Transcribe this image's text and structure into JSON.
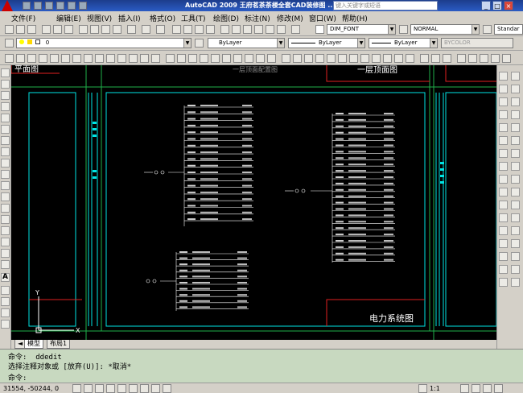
{
  "titlebar": {
    "title": "AutoCAD 2009  王府茗茶茶楼全套CAD装修图 ...",
    "search_placeholder": "键入关键字或短语",
    "min": "_",
    "max": "□",
    "close": "×"
  },
  "menu": [
    "文件(F)",
    "编辑(E)",
    "视图(V)",
    "插入(I)",
    "格式(O)",
    "工具(T)",
    "绘图(D)",
    "标注(N)",
    "修改(M)",
    "窗口(W)",
    "帮助(H)"
  ],
  "toolbar": {
    "textstyle": "DIM_FONT",
    "dimstyle": "NORMAL",
    "tablestyle": "Standar",
    "layer": "0",
    "color": "ByLayer",
    "linetype": "ByLayer",
    "lineweight": "ByLayer",
    "plotstyle": "BYCOLOR"
  },
  "drawing": {
    "labels": {
      "top_left": "平面图",
      "top_center": "一层顶面配置图",
      "top_right": "一层顶面图",
      "bottom_right": "电力系统图",
      "ucs_y": "Y",
      "ucs_x": "X"
    }
  },
  "tabs": [
    "模型",
    "布局1"
  ],
  "command": {
    "line1_prefix": "命令:",
    "line1_value": "ddedit",
    "line2": "选择注释对象或 [放弃(U)]: *取消*",
    "line3_prefix": "命令:"
  },
  "status": {
    "coords": "31554, -50244, 0",
    "scale": "1:1"
  }
}
